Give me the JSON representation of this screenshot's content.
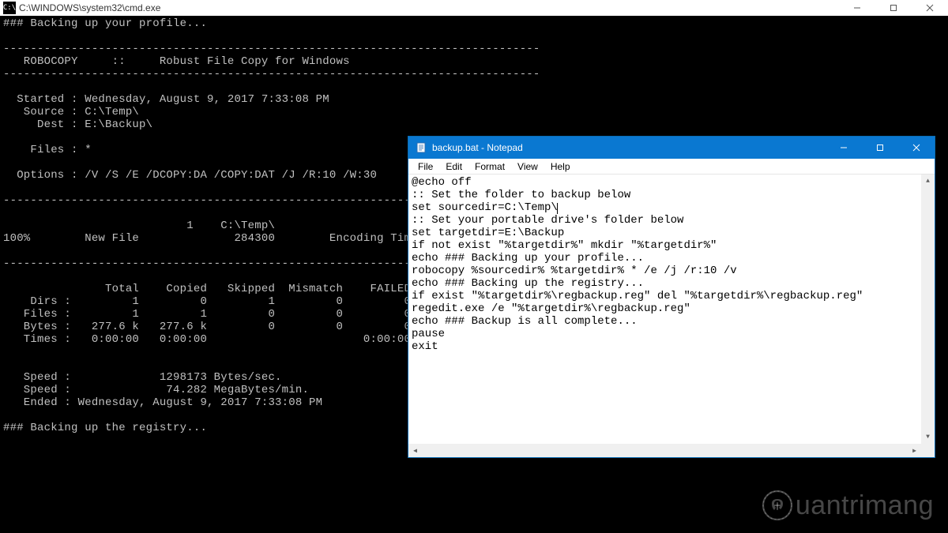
{
  "cmd": {
    "title": "C:\\WINDOWS\\system32\\cmd.exe",
    "icon_text": "C:\\",
    "output": "### Backing up your profile...\n\n-------------------------------------------------------------------------------\n   ROBOCOPY     ::     Robust File Copy for Windows\n-------------------------------------------------------------------------------\n\n  Started : Wednesday, August 9, 2017 7:33:08 PM\n   Source : C:\\Temp\\\n     Dest : E:\\Backup\\\n\n    Files : *\n\n  Options : /V /S /E /DCOPY:DA /COPY:DAT /J /R:10 /W:30\n\n------------------------------------------------------------------------------\n\n                           1    C:\\Temp\\\n100%        New File              284300        Encoding Time.csv\n\n------------------------------------------------------------------------------\n\n               Total    Copied   Skipped  Mismatch    FAILED    Extras\n    Dirs :         1         0         1         0         0         0\n   Files :         1         1         0         0         0         0\n   Bytes :   277.6 k   277.6 k         0         0         0         0\n   Times :   0:00:00   0:00:00                       0:00:00   0:00:00\n\n\n   Speed :             1298173 Bytes/sec.\n   Speed :              74.282 MegaBytes/min.\n   Ended : Wednesday, August 9, 2017 7:33:08 PM\n\n### Backing up the registry...\n"
  },
  "notepad": {
    "title": "backup.bat - Notepad",
    "menu": {
      "file": "File",
      "edit": "Edit",
      "format": "Format",
      "view": "View",
      "help": "Help"
    },
    "content_before_caret": "@echo off\n:: Set the folder to backup below\nset sourcedir=C:\\Temp\\",
    "content_after_caret": "\n:: Set your portable drive's folder below\nset targetdir=E:\\Backup\nif not exist \"%targetdir%\" mkdir \"%targetdir%\"\necho ### Backing up your profile...\nrobocopy %sourcedir% %targetdir% * /e /j /r:10 /v\necho ### Backing up the registry...\nif exist \"%targetdir%\\regbackup.reg\" del \"%targetdir%\\regbackup.reg\"\nregedit.exe /e \"%targetdir%\\regbackup.reg\"\necho ### Backup is all complete...\npause\nexit"
  },
  "watermark": "uantrimang"
}
